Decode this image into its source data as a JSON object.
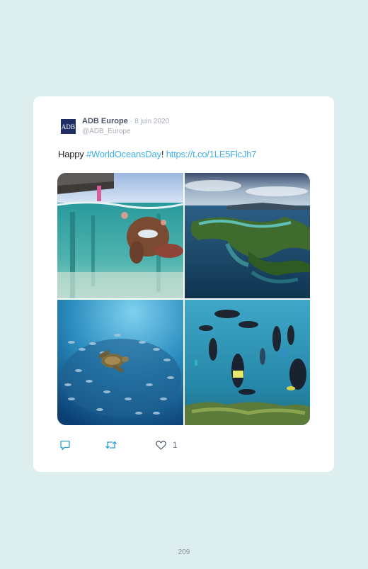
{
  "tweet": {
    "avatar_text": "ADB",
    "author_name": "ADB Europe",
    "separator": "·",
    "date": "8 juin 2020",
    "handle": "@ADB_Europe",
    "text_prefix": "Happy ",
    "hashtag": "#WorldOceansDay",
    "text_middle": "! ",
    "url": "https://t.co/1LE5FlcJh7",
    "photos": [
      {
        "subject": "boy snorkeling under pier"
      },
      {
        "subject": "aerial view of tropical islands"
      },
      {
        "subject": "sea turtle in school of fish"
      },
      {
        "subject": "divers over coral reef"
      }
    ],
    "actions": {
      "reply_icon": "reply-icon",
      "retweet_icon": "retweet-icon",
      "like_icon": "heart-icon",
      "like_count": "1"
    }
  },
  "colors": {
    "page_background": "#dcefee",
    "link": "#42b0e6",
    "avatar_bg": "#1f2f66"
  },
  "page_number": "209"
}
